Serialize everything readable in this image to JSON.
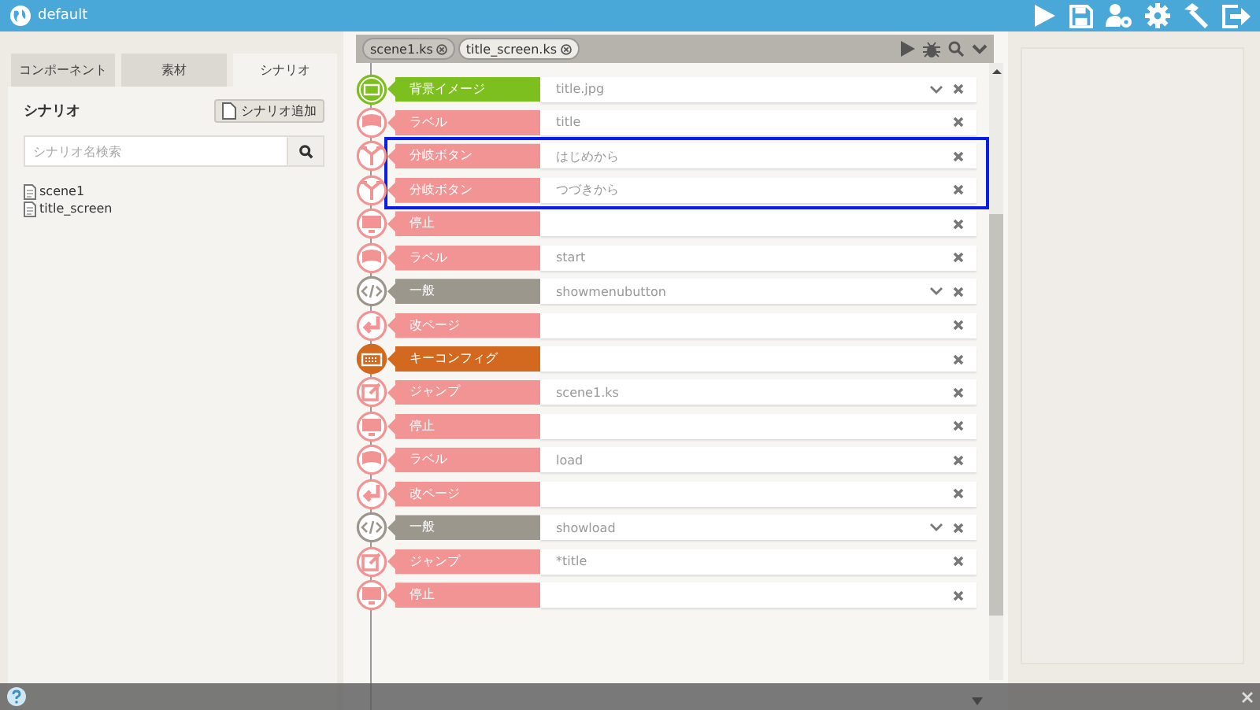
{
  "window": {
    "title": "default"
  },
  "sidebar": {
    "tabs": [
      {
        "label": "コンポーネント",
        "selected": false
      },
      {
        "label": "素材",
        "selected": false
      },
      {
        "label": "シナリオ",
        "selected": true
      }
    ],
    "heading": "シナリオ",
    "add_button": "シナリオ追加",
    "search": {
      "placeholder": "シナリオ名検索"
    },
    "files": [
      "scene1",
      "title_screen"
    ]
  },
  "editor": {
    "file_tabs": [
      {
        "label": "scene1.ks"
      },
      {
        "label": "title_screen.ks"
      }
    ],
    "rows": [
      {
        "kind": "image",
        "label": "背景イメージ",
        "value": "title.jpg",
        "color": "#7dbf1e",
        "dropdown": true,
        "selected": false
      },
      {
        "kind": "label",
        "label": "ラベル",
        "value": "title",
        "color": "#f39494",
        "dropdown": false,
        "selected": false
      },
      {
        "kind": "button",
        "label": "分岐ボタン",
        "value": "はじめから",
        "color": "#f39494",
        "dropdown": false,
        "selected": true
      },
      {
        "kind": "button",
        "label": "分岐ボタン",
        "value": "つづきから",
        "color": "#f39494",
        "dropdown": false,
        "selected": true
      },
      {
        "kind": "stop",
        "label": "停止",
        "value": "",
        "color": "#f39494",
        "dropdown": false,
        "selected": false
      },
      {
        "kind": "label",
        "label": "ラベル",
        "value": "start",
        "color": "#f39494",
        "dropdown": false,
        "selected": false
      },
      {
        "kind": "code",
        "label": "一般",
        "value": "showmenubutton",
        "color": "#9c978c",
        "dropdown": true,
        "selected": false
      },
      {
        "kind": "newpage",
        "label": "改ページ",
        "value": "",
        "color": "#f39494",
        "dropdown": false,
        "selected": false
      },
      {
        "kind": "keyconfig",
        "label": "キーコンフィグ",
        "value": "",
        "color": "#d2691e",
        "dropdown": false,
        "selected": false
      },
      {
        "kind": "jump",
        "label": "ジャンプ",
        "value": "scene1.ks",
        "color": "#f39494",
        "dropdown": false,
        "selected": false
      },
      {
        "kind": "stop",
        "label": "停止",
        "value": "",
        "color": "#f39494",
        "dropdown": false,
        "selected": false
      },
      {
        "kind": "label",
        "label": "ラベル",
        "value": "load",
        "color": "#f39494",
        "dropdown": false,
        "selected": false
      },
      {
        "kind": "newpage",
        "label": "改ページ",
        "value": "",
        "color": "#f39494",
        "dropdown": false,
        "selected": false
      },
      {
        "kind": "code",
        "label": "一般",
        "value": "showload",
        "color": "#9c978c",
        "dropdown": true,
        "selected": false
      },
      {
        "kind": "jump",
        "label": "ジャンプ",
        "value": "*title",
        "color": "#f39494",
        "dropdown": false,
        "selected": false
      },
      {
        "kind": "stop",
        "label": "停止",
        "value": "",
        "color": "#f39494",
        "dropdown": false,
        "selected": false
      }
    ]
  }
}
